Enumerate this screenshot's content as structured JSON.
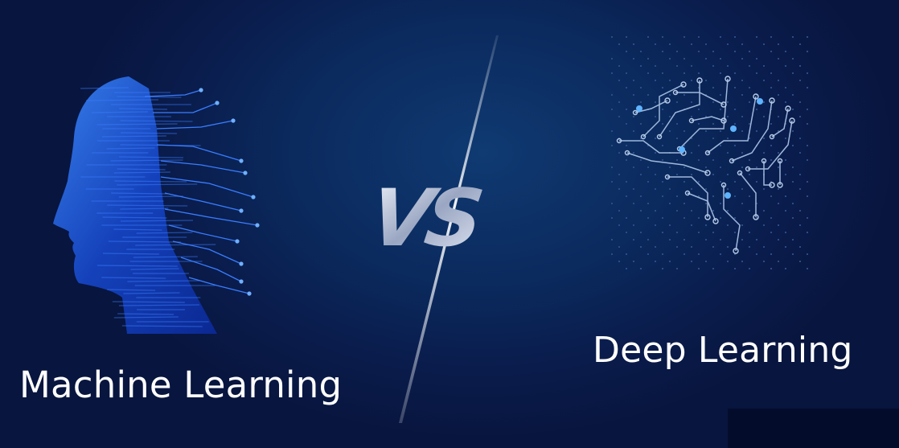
{
  "left": {
    "label": "Machine Learning",
    "icon": "ai-head-icon"
  },
  "center": {
    "label": "VS"
  },
  "right": {
    "label": "Deep Learning",
    "icon": "circuit-brain-icon"
  },
  "colors": {
    "background": "#0a1c4c",
    "accent": "#2f7bff",
    "glow": "#5fb4ff",
    "text": "#ffffff"
  }
}
